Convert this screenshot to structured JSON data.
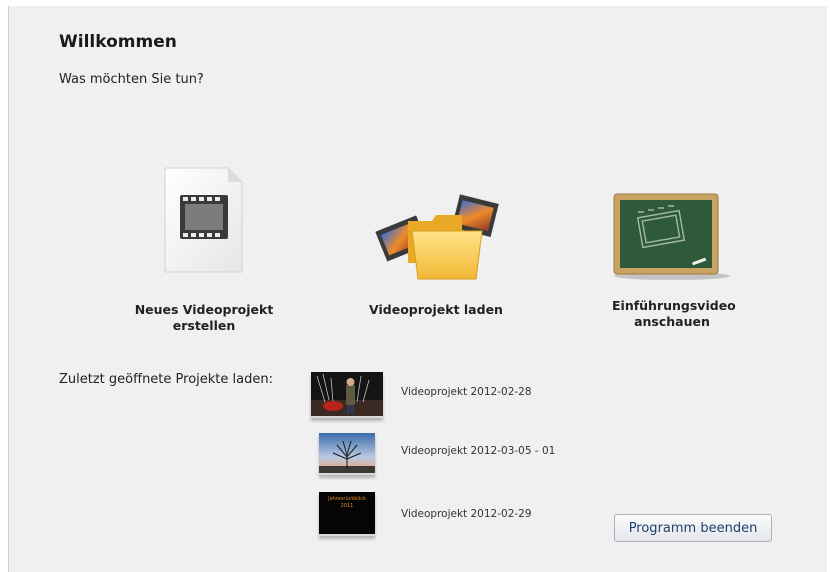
{
  "header": {
    "title": "Willkommen",
    "subtitle": "Was möchten Sie tun?"
  },
  "actions": [
    {
      "label": "Neues Videoprojekt erstellen",
      "icon": "new-video-project-icon"
    },
    {
      "label": "Videoprojekt laden",
      "icon": "open-folder-icon"
    },
    {
      "label": "Einführungsvideo anschauen",
      "icon": "chalkboard-icon"
    }
  ],
  "recent": {
    "heading": "Zuletzt geöffnete Projekte laden:",
    "items": [
      {
        "label": "Videoprojekt 2012-02-28",
        "thumb": "person-night-thumbnail"
      },
      {
        "label": "Videoprojekt 2012-03-05 - 01",
        "thumb": "tree-sunset-thumbnail"
      },
      {
        "label": "Videoprojekt 2012-02-29",
        "thumb": "title-card-thumbnail",
        "thumb_text": "Jahresrückblick  2011"
      }
    ]
  },
  "footer": {
    "quit_label": "Programm beenden"
  },
  "colors": {
    "panel_bg": "#f0f0f1",
    "button_text": "#1f3f6e",
    "chalkboard": "#2f5a3a",
    "wood": "#c9a361"
  }
}
